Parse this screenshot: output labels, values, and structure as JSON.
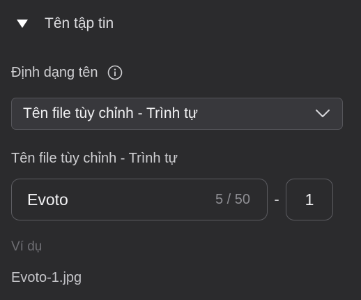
{
  "section": {
    "title": "Tên tập tin",
    "caret_icon": "caret-down-icon",
    "expanded": true
  },
  "name_format": {
    "label": "Định dạng tên",
    "info_icon": "info-icon",
    "selected": "Tên file tùy chỉnh - Trình tự",
    "chevron_icon": "chevron-down-icon"
  },
  "custom_name": {
    "label": "Tên file tùy chỉnh - Trình tự",
    "value": "Evoto",
    "counter": "5 / 50",
    "separator": "-",
    "sequence": "1"
  },
  "example": {
    "label": "Ví dụ",
    "value": "Evoto-1.jpg"
  },
  "colors": {
    "background": "#2b2b2d",
    "field_border": "#5c5c61",
    "select_bg": "#38383c",
    "text_primary": "#f2f2f4",
    "text_muted": "#6e6e73"
  }
}
